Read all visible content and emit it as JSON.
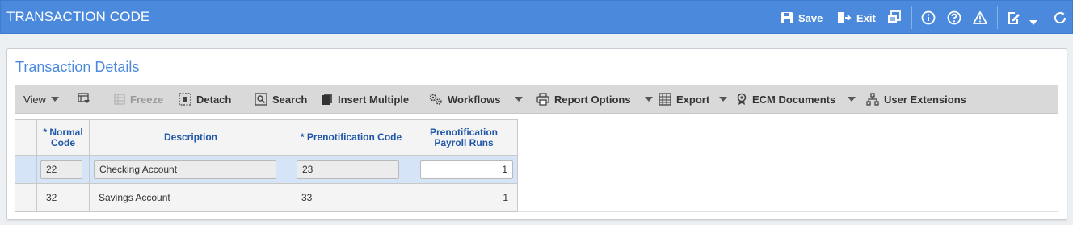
{
  "window": {
    "title": "TRANSACTION CODE"
  },
  "header_actions": {
    "save_label": "Save",
    "exit_label": "Exit"
  },
  "panel": {
    "title": "Transaction Details"
  },
  "toolbar": {
    "view": "View",
    "freeze": "Freeze",
    "detach": "Detach",
    "search": "Search",
    "insert_multiple": "Insert Multiple",
    "workflows": "Workflows",
    "report_options": "Report Options",
    "export": "Export",
    "ecm_documents": "ECM Documents",
    "user_extensions": "User Extensions"
  },
  "grid": {
    "columns": {
      "normal_code": [
        "* Normal",
        "Code"
      ],
      "description": "Description",
      "prenotification_code": "* Prenotification Code",
      "prenotification_runs": [
        "Prenotification",
        "Payroll Runs"
      ]
    },
    "rows": [
      {
        "normal_code": "22",
        "description": "Checking Account",
        "prenotification_code": "23",
        "prenotification_runs": "1"
      },
      {
        "normal_code": "32",
        "description": "Savings Account",
        "prenotification_code": "33",
        "prenotification_runs": "1"
      }
    ]
  },
  "icons": {
    "save": "floppy-disk-icon",
    "exit": "exit-door-icon",
    "copy": "duplicate-icon",
    "info": "info-icon",
    "help": "question-icon",
    "alert": "warning-icon",
    "edit": "edit-icon",
    "refresh": "refresh-icon"
  },
  "colors": {
    "brand": "#4a89dc",
    "header_text": "#1f56a8",
    "selected_row": "#d6e4f8"
  }
}
